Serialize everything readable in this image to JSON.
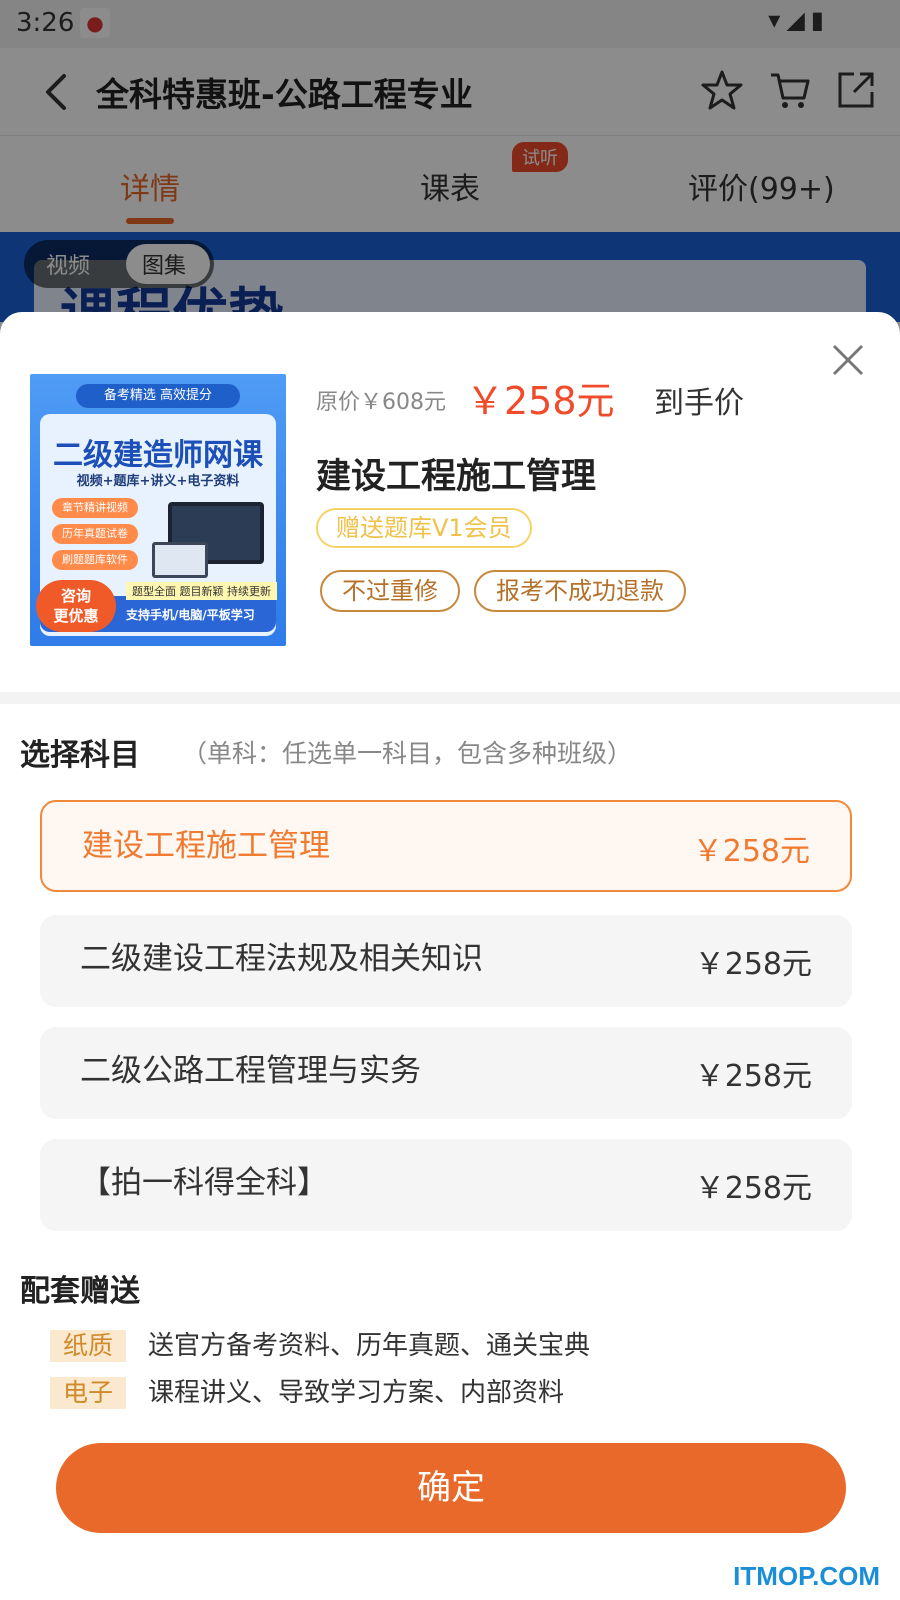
{
  "status_bar": {
    "time": "3:26",
    "app_icon": "mascot-icon"
  },
  "header": {
    "title": "全科特惠班-公路工程专业",
    "icons": [
      "back-icon",
      "star-icon",
      "cart-icon",
      "share-icon"
    ]
  },
  "tabs": [
    {
      "label": "详情",
      "active": true
    },
    {
      "label": "课表",
      "badge": "试听"
    },
    {
      "label": "评价(99+)"
    }
  ],
  "background": {
    "banner_heading": "课程优势",
    "media_toggle": [
      "视频",
      "图集"
    ],
    "media_selected": "图集"
  },
  "sheet": {
    "product_image": {
      "top_text": "备考精选  高效提分",
      "title": "二级建造师网课",
      "subtitle": "视频+题库+讲义+电子资料",
      "features": [
        "章节精讲视频",
        "历年真题试卷",
        "刷题题库软件"
      ],
      "badge": "咨询\n更优惠",
      "strip": "题型全面  题目新颖  持续更新",
      "footer": "支持手机/电脑/平板学习"
    },
    "original_price": "原价￥608元",
    "sale_price": "￥258元",
    "final_price_label": "到手价",
    "course_name": "建设工程施工管理",
    "gift_badge": "赠送题库V1会员",
    "promises": [
      "不过重修",
      "报考不成功退款"
    ],
    "select_section": {
      "title": "选择科目",
      "note": "（单科：任选单一科目，包含多种班级）"
    },
    "options": [
      {
        "name": "建设工程施工管理",
        "price": "￥258元",
        "selected": true
      },
      {
        "name": "二级建设工程法规及相关知识",
        "price": "￥258元",
        "selected": false
      },
      {
        "name": "二级公路工程管理与实务",
        "price": "￥258元",
        "selected": false
      },
      {
        "name": "【拍一科得全科】",
        "price": "￥258元",
        "selected": false
      }
    ],
    "gifts_section": {
      "title": "配套赠送",
      "items": [
        {
          "tag": "纸质",
          "text": "送官方备考资料、历年真题、通关宝典"
        },
        {
          "tag": "电子",
          "text": "课程讲义、导致学习方案、内部资料"
        }
      ]
    },
    "confirm_label": "确定"
  },
  "watermark": "ITMOP.COM",
  "colors": {
    "accent": "#e8692a",
    "price_red": "#f04b2a",
    "gold": "#f0c24a"
  }
}
